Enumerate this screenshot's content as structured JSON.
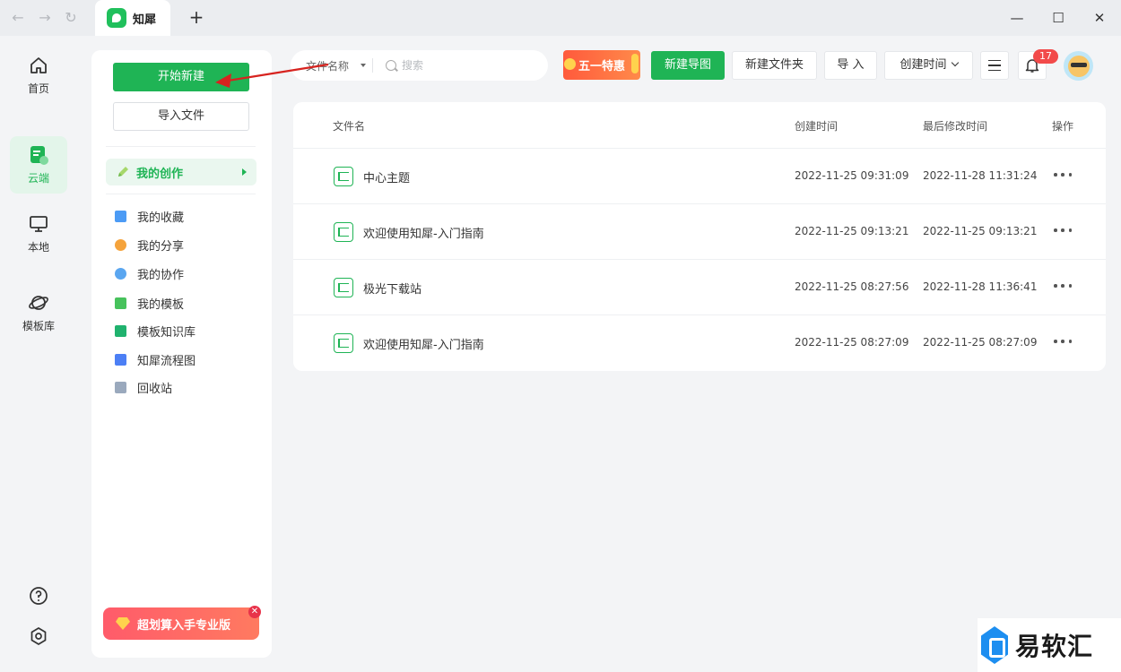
{
  "app": {
    "tab_title": "知犀"
  },
  "rail": {
    "items": [
      {
        "label": "首页",
        "icon": "home-icon"
      },
      {
        "label": "云端",
        "icon": "cloud-file-icon"
      },
      {
        "label": "本地",
        "icon": "monitor-icon"
      },
      {
        "label": "模板库",
        "icon": "planet-icon"
      }
    ],
    "active": "云端"
  },
  "sidebar": {
    "new_label": "开始新建",
    "import_label": "导入文件",
    "section_label": "我的创作",
    "items": [
      {
        "label": "我的收藏",
        "icon": "folder-star-icon",
        "color": "#4c9bf5"
      },
      {
        "label": "我的分享",
        "icon": "share-icon",
        "color": "#f5a33c"
      },
      {
        "label": "我的协作",
        "icon": "people-icon",
        "color": "#5aa6f0"
      },
      {
        "label": "我的模板",
        "icon": "template-icon",
        "color": "#47c25c"
      },
      {
        "label": "模板知识库",
        "icon": "book-icon",
        "color": "#20b26e"
      },
      {
        "label": "知犀流程图",
        "icon": "flowchart-icon",
        "color": "#4c7ff5"
      },
      {
        "label": "回收站",
        "icon": "trash-icon",
        "color": "#9aa9bd"
      }
    ],
    "promo_label": "超划算入手专业版"
  },
  "toolbar": {
    "search_type": "文件名称",
    "search_placeholder": "搜索",
    "promo_label": "五一特惠",
    "new_map": "新建导图",
    "new_folder": "新建文件夹",
    "import": "导 入",
    "sort": "创建时间",
    "notification_count": "17"
  },
  "list": {
    "headers": {
      "name": "文件名",
      "created": "创建时间",
      "modified": "最后修改时间",
      "actions": "操作"
    },
    "rows": [
      {
        "name": "中心主题",
        "created": "2022-11-25 09:31:09",
        "modified": "2022-11-28 11:31:24"
      },
      {
        "name": "欢迎使用知犀-入门指南",
        "created": "2022-11-25 09:13:21",
        "modified": "2022-11-25 09:13:21"
      },
      {
        "name": "极光下载站",
        "created": "2022-11-25 08:27:56",
        "modified": "2022-11-28 11:36:41"
      },
      {
        "name": "欢迎使用知犀-入门指南",
        "created": "2022-11-25 08:27:09",
        "modified": "2022-11-25 08:27:09"
      }
    ]
  },
  "watermark": {
    "text": "易软汇"
  },
  "colors": {
    "brand": "#1fb455",
    "annotation": "#d7231f"
  }
}
